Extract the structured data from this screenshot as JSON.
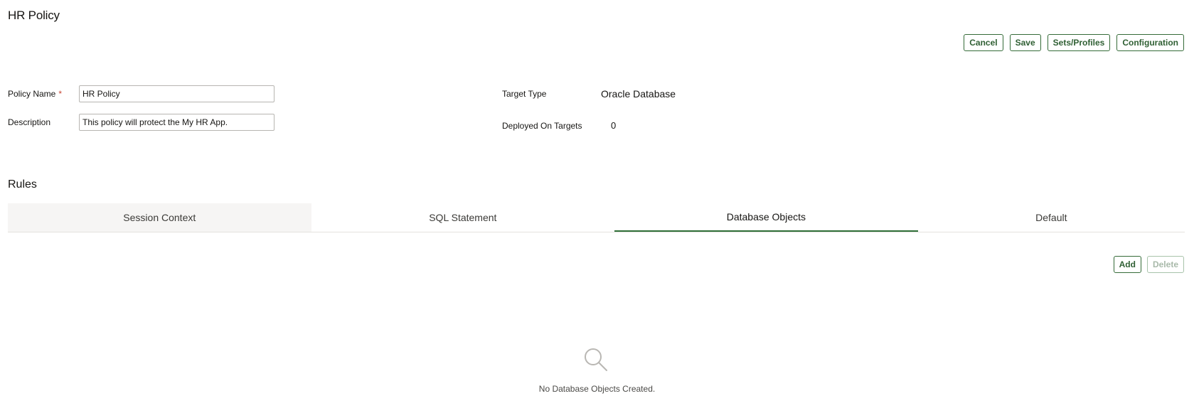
{
  "page": {
    "title": "HR Policy"
  },
  "toolbar": {
    "cancel_label": "Cancel",
    "save_label": "Save",
    "sets_profiles_label": "Sets/Profiles",
    "configuration_label": "Configuration"
  },
  "form": {
    "policy_name": {
      "label": "Policy Name",
      "required_marker": "*",
      "value": "HR Policy"
    },
    "description": {
      "label": "Description",
      "value": "This policy will protect the My HR App."
    },
    "target_type": {
      "label": "Target Type",
      "value": "Oracle Database"
    },
    "deployed_on_targets": {
      "label": "Deployed On Targets",
      "value": "0"
    }
  },
  "rules": {
    "title": "Rules",
    "tabs": [
      {
        "label": "Session Context"
      },
      {
        "label": "SQL Statement"
      },
      {
        "label": "Database Objects"
      },
      {
        "label": "Default"
      }
    ],
    "active_tab": "Database Objects",
    "actions": {
      "add_label": "Add",
      "delete_label": "Delete"
    },
    "empty_state": {
      "icon": "search-icon",
      "message": "No Database Objects Created."
    }
  },
  "colors": {
    "accent": "#2f6f38",
    "required": "#c74634",
    "tab_shade": "#f6f5f4"
  }
}
